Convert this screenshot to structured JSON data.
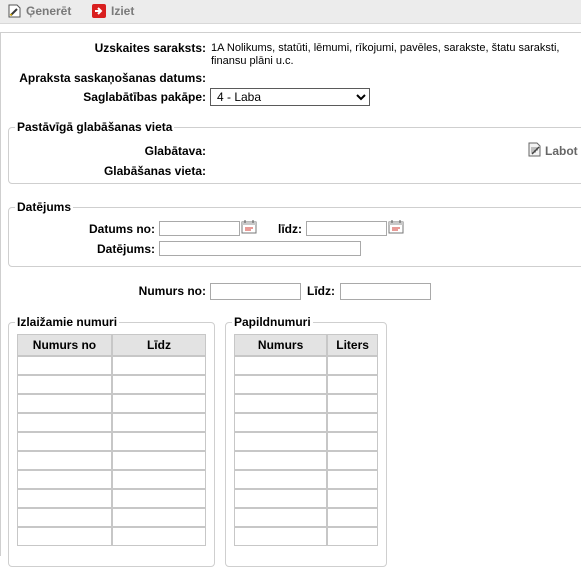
{
  "toolbar": {
    "generate_label": "Ģenerēt",
    "exit_label": "Iziet"
  },
  "form": {
    "registry_label": "Uzskaites saraksts:",
    "registry_value": "1A  Nolikums, statūti, lēmumi, rīkojumi, pavēles, sarakste, štatu saraksti, finansu plāni u.c.",
    "approval_date_label": "Apraksta saskaņošanas datums:",
    "preservation_label": "Saglabātības pakāpe:",
    "preservation_value": "4 - Laba"
  },
  "storage": {
    "legend": "Pastāvīgā glabāšanas vieta",
    "repository_label": "Glabātava:",
    "location_label": "Glabāšanas vieta:",
    "edit_label": "Labot"
  },
  "dating": {
    "legend": "Datējums",
    "date_from_label": "Datums no:",
    "date_to_label": "līdz:",
    "dating_label": "Datējums:"
  },
  "numbers": {
    "from_label": "Numurs no:",
    "to_label": "Līdz:"
  },
  "excluded": {
    "legend": "Izlaižamie numuri",
    "col_from": "Numurs no",
    "col_to": "Līdz"
  },
  "additional": {
    "legend": "Papildnumuri",
    "col_number": "Numurs",
    "col_letter": "Liters"
  }
}
